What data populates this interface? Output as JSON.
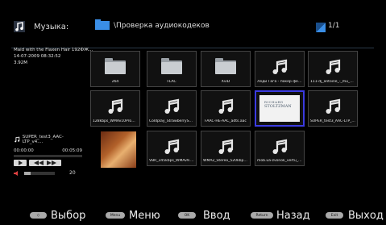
{
  "header": {
    "title": "Музыка:",
    "path": "\\Проверка аудиокодеков",
    "page": "1/1"
  },
  "info": {
    "line1": "Maid with the Flaxen Hair 192ФЖ...",
    "line2": "14-07-2009 08:32:52",
    "line3": "3.92M"
  },
  "player": {
    "track": "SUPER_test3_AAC-LTP_v4....",
    "time_current": "00:00:00",
    "time_total": "00:05:09",
    "progress": 0.0,
    "volume_value": "20",
    "volume_fraction": 0.2
  },
  "tiles": [
    {
      "label": "264",
      "kind": "folder"
    },
    {
      "label": "FLAC",
      "kind": "folder"
    },
    {
      "label": "XviD",
      "kind": "folder"
    },
    {
      "label": "Леди Гага - покер фейс ...",
      "kind": "music"
    },
    {
      "label": "111-dj_antoine_-_mu_ch...",
      "kind": "music"
    },
    {
      "label": "128kbps_WMAv10ProM...",
      "kind": "music"
    },
    {
      "label": "Coldplay_StrawberrySwin...",
      "kind": "music"
    },
    {
      "label": "FAAC-HE-AAC_adts.aac",
      "kind": "music"
    },
    {
      "label": "",
      "kind": "cover"
    },
    {
      "label": "SUPER_test3_AAC-LTP_v...",
      "kind": "music"
    },
    {
      "label": "VBR_345kbps_WMAv9.2...",
      "kind": "music"
    },
    {
      "label": "WMA2_Stereo_520kbps...",
      "kind": "music"
    },
    {
      "label": "mob.ua-zvonok_vertu_6...",
      "kind": "music"
    }
  ],
  "cover": {
    "line1": "RICHARD",
    "line2": "STOLTZMAN"
  },
  "footer": {
    "select_key": "◇",
    "select_label": "Выбор",
    "menu_key": "Menu",
    "menu_label": "Меню",
    "ok_key": "OK",
    "ok_label": "Ввод",
    "return_key": "Return",
    "return_label": "Назад",
    "exit_key": "Exit",
    "exit_label": "Выход"
  },
  "colors": {
    "accent": "#3b3be0",
    "folder": "#9aa0a6",
    "note": "#e6e6e6"
  },
  "icons": [
    "music-note-icon",
    "folder-icon",
    "pager-icon",
    "play-icon",
    "rewind-icon",
    "forward-icon",
    "volume-icon"
  ]
}
